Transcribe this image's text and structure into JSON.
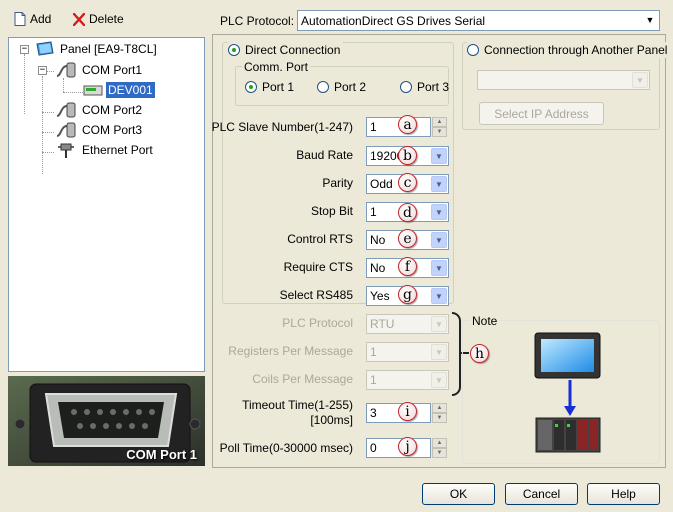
{
  "toolbar": {
    "add_label": "Add",
    "delete_label": "Delete"
  },
  "tree": {
    "panel": "Panel [EA9-T8CL]",
    "com1": "COM Port1",
    "dev": "DEV001",
    "com2": "COM Port2",
    "com3": "COM Port3",
    "eth": "Ethernet Port"
  },
  "preview": {
    "caption": "COM Port 1"
  },
  "protocol": {
    "label": "PLC Protocol:",
    "value": "AutomationDirect GS Drives Serial"
  },
  "direct": {
    "label": "Direct Connection",
    "selected": true
  },
  "comm_port": {
    "title": "Comm. Port",
    "options": [
      "Port 1",
      "Port 2",
      "Port 3"
    ],
    "selected": "Port 1"
  },
  "another": {
    "label": "Connection through Another Panel",
    "select_ip": "Select IP Address"
  },
  "fields": {
    "slave": {
      "label": "PLC Slave Number(1-247)",
      "value": "1",
      "badge": "a"
    },
    "baud": {
      "label": "Baud Rate",
      "value": "19200",
      "badge": "b"
    },
    "parity": {
      "label": "Parity",
      "value": "Odd",
      "badge": "c"
    },
    "stop": {
      "label": "Stop Bit",
      "value": "1",
      "badge": "d"
    },
    "rts": {
      "label": "Control RTS",
      "value": "No",
      "badge": "e"
    },
    "cts": {
      "label": "Require CTS",
      "value": "No",
      "badge": "f"
    },
    "rs485": {
      "label": "Select RS485",
      "value": "Yes",
      "badge": "g"
    },
    "plcproto": {
      "label": "PLC Protocol",
      "value": "RTU"
    },
    "regs": {
      "label": "Registers Per Message",
      "value": "1"
    },
    "coils": {
      "label": "Coils Per Message",
      "value": "1"
    },
    "h_badge": "h",
    "timeout_label1": "Timeout Time(1-255)",
    "timeout_label2": "[100ms]",
    "timeout_value": "3",
    "timeout_badge": "i",
    "poll": {
      "label": "Poll Time(0-30000 msec)",
      "value": "0",
      "badge": "j"
    }
  },
  "note": {
    "title": "Note"
  },
  "buttons": {
    "ok": "OK",
    "cancel": "Cancel",
    "help": "Help"
  },
  "colors": {
    "selection": "#316ac5",
    "badge_ring": "#c0262d",
    "face": "#ece9d8"
  }
}
